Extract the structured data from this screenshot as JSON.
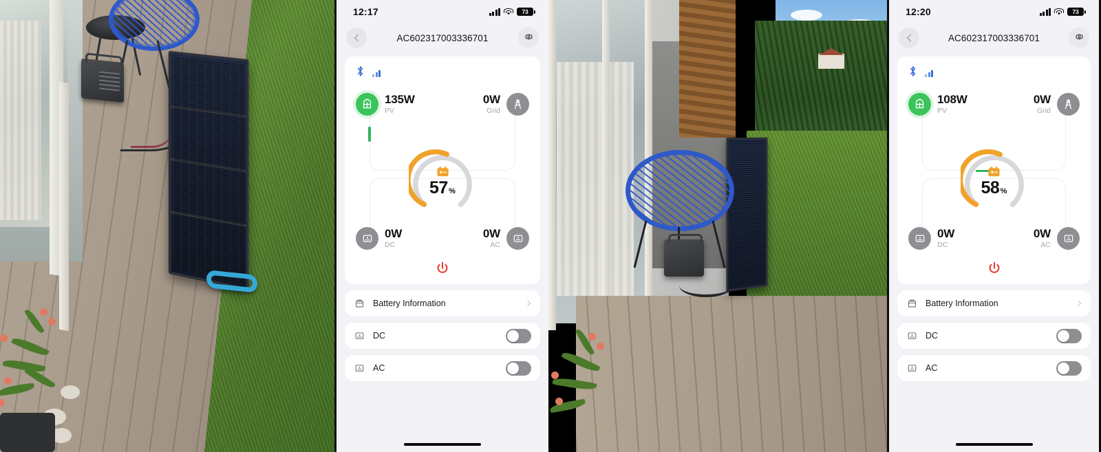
{
  "panels": [
    {
      "type": "photo",
      "name": "photo-deck-solar-panel",
      "alt": "Portable solar panel unfolded on a wooden deck next to a portable power station, lawn at right"
    },
    {
      "type": "phone",
      "name": "app-screen-first",
      "status_bar": {
        "time": "12:17",
        "signal_icon": "cellular-signal-icon",
        "wifi_icon": "wifi-icon",
        "battery_icon": "battery-icon",
        "battery_level": "73"
      },
      "nav": {
        "back_icon": "chevron-left-icon",
        "title": "AC602317003336701",
        "settings_icon": "gear-icon"
      },
      "connection": {
        "bluetooth_icon": "bluetooth-icon",
        "signal_icon": "signal-bars-icon"
      },
      "nodes": {
        "pv": {
          "icon": "solar-panel-icon",
          "value": "135W",
          "label": "PV"
        },
        "grid": {
          "icon": "power-grid-tower-icon",
          "value": "0W",
          "label": "Grid"
        },
        "dc": {
          "icon": "dc-output-icon",
          "value": "0W",
          "label": "DC"
        },
        "ac": {
          "icon": "ac-output-icon",
          "value": "0W",
          "label": "AC"
        }
      },
      "gauge": {
        "icon": "battery-charge-icon",
        "percent": "57",
        "percent_sign": "%",
        "value": 57,
        "arc_color": "#F0A32B",
        "track_color": "#D8D8DC"
      },
      "flow": {
        "active_edge": "pv-vertical",
        "color": "#33B35A"
      },
      "power_button": {
        "icon": "power-icon",
        "color": "#E8352B"
      },
      "rows": [
        {
          "icon": "battery-info-icon",
          "label": "Battery Information",
          "accessory": "chevron-right-icon"
        },
        {
          "icon": "dc-output-icon",
          "label": "DC",
          "accessory": "toggle",
          "toggle_on": false
        },
        {
          "icon": "ac-output-icon",
          "label": "AC",
          "accessory": "toggle",
          "toggle_on": false
        }
      ],
      "home_indicator": "home-indicator"
    },
    {
      "type": "photo",
      "name": "photo-balcony-chair-solar",
      "alt": "Blue string chair and folded solar panel on a wooden balcony deck with green lawn and trees"
    },
    {
      "type": "phone",
      "name": "app-screen-second",
      "status_bar": {
        "time": "12:20",
        "signal_icon": "cellular-signal-icon",
        "wifi_icon": "wifi-icon",
        "battery_icon": "battery-icon",
        "battery_level": "73"
      },
      "nav": {
        "back_icon": "chevron-left-icon",
        "title": "AC602317003336701",
        "settings_icon": "gear-icon"
      },
      "connection": {
        "bluetooth_icon": "bluetooth-icon",
        "signal_icon": "signal-bars-icon"
      },
      "nodes": {
        "pv": {
          "icon": "solar-panel-icon",
          "value": "108W",
          "label": "PV"
        },
        "grid": {
          "icon": "power-grid-tower-icon",
          "value": "0W",
          "label": "Grid"
        },
        "dc": {
          "icon": "dc-output-icon",
          "value": "0W",
          "label": "DC"
        },
        "ac": {
          "icon": "ac-output-icon",
          "value": "0W",
          "label": "AC"
        }
      },
      "gauge": {
        "icon": "battery-charge-icon",
        "percent": "58",
        "percent_sign": "%",
        "value": 58,
        "arc_color": "#F0A32B",
        "track_color": "#D8D8DC"
      },
      "flow": {
        "active_edge": "pv-horizontal",
        "color": "#33B35A"
      },
      "power_button": {
        "icon": "power-icon",
        "color": "#E8352B"
      },
      "rows": [
        {
          "icon": "battery-info-icon",
          "label": "Battery Information",
          "accessory": "chevron-right-icon"
        },
        {
          "icon": "dc-output-icon",
          "label": "DC",
          "accessory": "toggle",
          "toggle_on": false
        },
        {
          "icon": "ac-output-icon",
          "label": "AC",
          "accessory": "toggle",
          "toggle_on": false
        }
      ],
      "home_indicator": "home-indicator"
    }
  ],
  "theme": {
    "page_bg": "#F2F2F7",
    "card_bg": "#FFFFFF",
    "accent_green": "#3CC35B",
    "accent_orange": "#F0A32B",
    "gray": "#8E8E93",
    "red": "#E8352B",
    "text": "#111111",
    "muted": "#A6A6AC"
  }
}
